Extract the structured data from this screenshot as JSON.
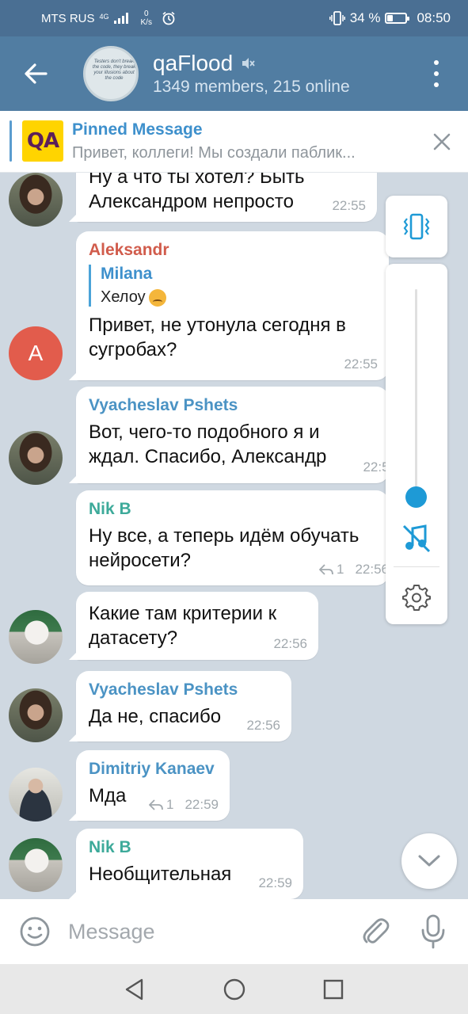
{
  "status": {
    "carrier": "MTS RUS",
    "network": "4G",
    "speed_value": "0",
    "speed_unit": "K/s",
    "battery": "34 %",
    "battery_level": 0.34,
    "time": "08:50"
  },
  "header": {
    "title": "qaFlood",
    "subtitle": "1349 members, 215 online",
    "avatar_text": "Testers don't break the code, they break your illusions about the code",
    "muted_icon": "muted-speaker-icon"
  },
  "pinned": {
    "logo": "QA",
    "title": "Pinned Message",
    "text": "Привет, коллеги! Мы создали паблик..."
  },
  "messages": [
    {
      "avatar": "person",
      "sender": "",
      "text": "Ну а что ты хотел? Быть Александром непросто",
      "time": "22:55"
    },
    {
      "avatar": "letter",
      "avatar_letter": "A",
      "sender": "Aleksandr",
      "sender_color": "#d15c4c",
      "quote_name": "Milana",
      "quote_text": "Хелоу",
      "text": "Привет, не утонула сегодня в сугробах?",
      "time": "22:55"
    },
    {
      "avatar": "person",
      "sender": "Vyacheslav Pshets",
      "sender_color": "#4b93c4",
      "text": "Вот, чего-то подобного я и ждал. Спасибо, Александр",
      "time": "22:55"
    },
    {
      "avatar": "",
      "sender": "Nik B",
      "sender_color": "#3daa9a",
      "text": "Ну все, а теперь идём обучать нейросети?",
      "replies": "1",
      "time": "22:56"
    },
    {
      "avatar": "cat",
      "sender": "",
      "text": "Какие там критерии к датасету?",
      "time": "22:56"
    },
    {
      "avatar": "person",
      "sender": "Vyacheslav Pshets",
      "sender_color": "#4b93c4",
      "text": "Да не, спасибо",
      "time": "22:56"
    },
    {
      "avatar": "man",
      "sender": "Dimitriy Kanaev",
      "sender_color": "#4b93c4",
      "text": "Мда",
      "replies": "1",
      "time": "22:59"
    },
    {
      "avatar": "cat",
      "sender": "Nik B",
      "sender_color": "#3daa9a",
      "text": "Необщительная",
      "time": "22:59"
    }
  ],
  "volume_panel": {
    "level": 0.05,
    "vibrate_icon": "vibrate-icon",
    "mute_icon": "music-off-icon",
    "settings_icon": "gear-icon"
  },
  "input": {
    "placeholder": "Message"
  },
  "colors": {
    "header": "#517da2",
    "status_bar": "#4a6f93",
    "accent": "#1e9ad6"
  }
}
